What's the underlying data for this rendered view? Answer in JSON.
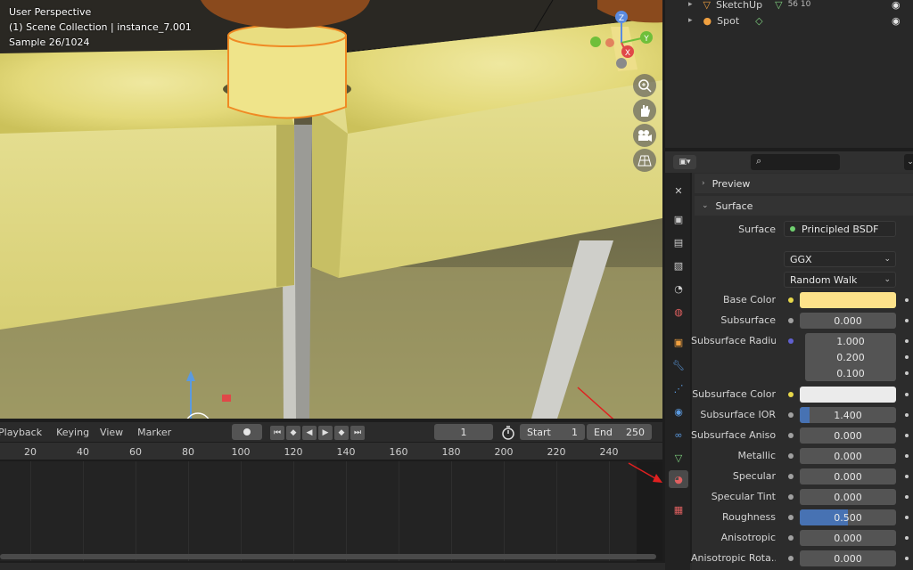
{
  "viewport": {
    "overlay_lines": [
      "User Perspective",
      "(1) Scene Collection | instance_7.001",
      "Sample 26/1024"
    ],
    "gizmo_axes": [
      "Z",
      "Y",
      "X"
    ]
  },
  "timeline": {
    "menus": [
      "Playback",
      "Keying",
      "View",
      "Marker"
    ],
    "current_frame": "1",
    "start_label": "Start",
    "start_value": "1",
    "end_label": "End",
    "end_value": "250",
    "ticks": [
      "20",
      "40",
      "60",
      "80",
      "100",
      "120",
      "140",
      "160",
      "180",
      "200",
      "220",
      "240"
    ]
  },
  "outliner": {
    "items": [
      {
        "label": "SketchUp",
        "extra": "56 10"
      },
      {
        "label": "Spot",
        "extra": ""
      }
    ]
  },
  "properties": {
    "search_placeholder": "",
    "panels": {
      "preview": "Preview",
      "surface": "Surface"
    },
    "surface_label": "Surface",
    "surface_value": "Principled BSDF",
    "distribution": "GGX",
    "subsurface_method": "Random Walk",
    "rows": [
      {
        "label": "Base Color",
        "type": "color",
        "color": "#fde28a"
      },
      {
        "label": "Subsurface",
        "type": "num",
        "value": "0.000",
        "fill": 0
      },
      {
        "label": "Subsurface Radius",
        "type": "vec",
        "values": [
          "1.000",
          "0.200",
          "0.100"
        ]
      },
      {
        "label": "Subsurface Color",
        "type": "color",
        "color": "#ebebeb"
      },
      {
        "label": "Subsurface IOR",
        "type": "num",
        "value": "1.400",
        "fill": 0.1
      },
      {
        "label": "Subsurface Aniso...",
        "type": "num",
        "value": "0.000",
        "fill": 0
      },
      {
        "label": "Metallic",
        "type": "num",
        "value": "0.000",
        "fill": 0
      },
      {
        "label": "Specular",
        "type": "num",
        "value": "0.000",
        "fill": 0
      },
      {
        "label": "Specular Tint",
        "type": "num",
        "value": "0.000",
        "fill": 0
      },
      {
        "label": "Roughness",
        "type": "num",
        "value": "0.500",
        "fill": 0.5
      },
      {
        "label": "Anisotropic",
        "type": "num",
        "value": "0.000",
        "fill": 0
      },
      {
        "label": "Anisotropic Rota...",
        "type": "num",
        "value": "0.000",
        "fill": 0
      }
    ]
  },
  "colors": {
    "accent": "#4772b3",
    "annotation_arrow": "#e02020",
    "selection": "#f08a24"
  }
}
